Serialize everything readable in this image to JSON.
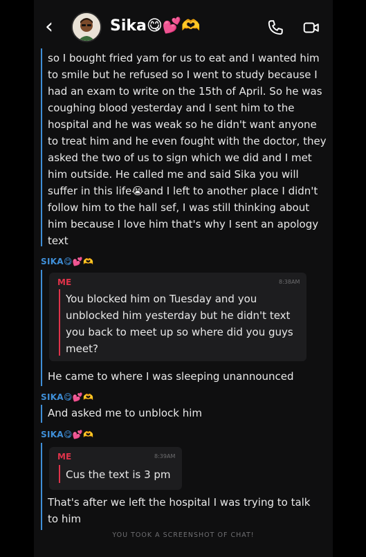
{
  "header": {
    "name": "Sika😋💕🫶"
  },
  "messages": {
    "m1": "so I bought fried yam for us to eat and I wanted him to smile but he refused so I went to study because I had an exam to write on the 15th of April. So he was coughing blood yesterday and I sent him to the hospital and he was weak so he didn't want anyone to treat him and he even fought with the doctor, they asked the two of us to sign which we did and I met him outside.  He called me and said Sika you will suffer in this life😭and I left to another place I didn't follow him to the hall sef, I was still thinking about him because I love him that's why I sent an apology text",
    "sender1": "SIKA😋💕🫶",
    "quote1_sender": "ME",
    "quote1_time": "8:38AM",
    "quote1_text": "You blocked him on Tuesday and you unblocked him yesterday  but he didn't text you back to meet up so where did you guys meet?",
    "m2": "He came to where I was sleeping unannounced",
    "sender2": "SIKA😋💕🫶",
    "m3": "And asked me to unblock him",
    "sender3": "SIKA😋💕🫶",
    "quote2_sender": "ME",
    "quote2_time": "8:39AM",
    "quote2_text": "Cus the text is 3 pm",
    "m4": "That's after we left the hospital I was trying to talk to him"
  },
  "footer": "YOU TOOK A SCREENSHOT OF CHAT!"
}
